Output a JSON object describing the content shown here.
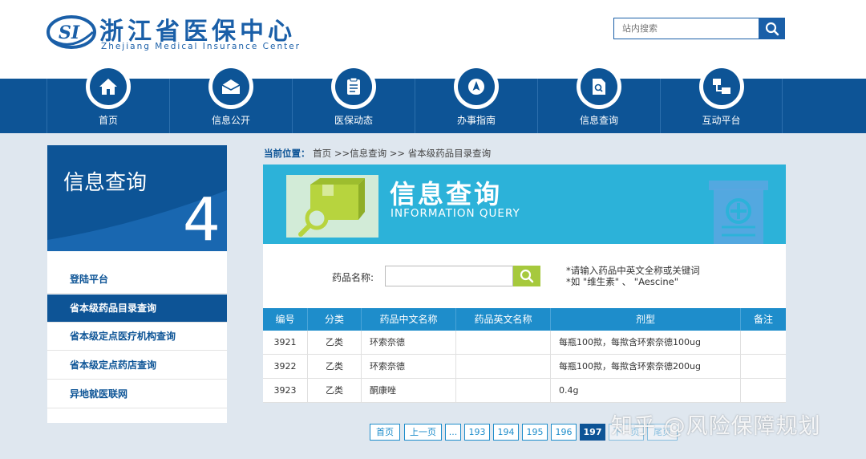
{
  "header": {
    "logo_text": "SI",
    "title": "浙江省医保中心",
    "subtitle": "Zhejiang Medical Insurance Center",
    "search": {
      "placeholder": "站内搜索"
    }
  },
  "nav": {
    "items": [
      {
        "label": "首页",
        "icon": "home-icon"
      },
      {
        "label": "信息公开",
        "icon": "envelope-icon"
      },
      {
        "label": "医保动态",
        "icon": "document-icon"
      },
      {
        "label": "办事指南",
        "icon": "compass-icon"
      },
      {
        "label": "信息查询",
        "icon": "file-search-icon"
      },
      {
        "label": "互动平台",
        "icon": "network-icon"
      }
    ]
  },
  "sidebar": {
    "title": "信息查询",
    "number": "4",
    "items": [
      {
        "label": "登陆平台"
      },
      {
        "label": "省本级药品目录查询",
        "active": true
      },
      {
        "label": "省本级定点医疗机构查询"
      },
      {
        "label": "省本级定点药店查询"
      },
      {
        "label": "异地就医联网"
      }
    ]
  },
  "breadcrumb": {
    "prefix": "当前位置：",
    "items": [
      "首页",
      ">>信息查询",
      ">>",
      "省本级药品目录查询"
    ]
  },
  "banner": {
    "title": "信息查询",
    "subtitle": "INFORMATION QUERY"
  },
  "query": {
    "label": "药品名称:",
    "value": "",
    "hint_line1": "*请输入药品中英文全称或关键词",
    "hint_line2": "*如 \"维生素\" 、 \"Aescine\""
  },
  "table": {
    "headers": [
      "编号",
      "分类",
      "药品中文名称",
      "药品英文名称",
      "剂型",
      "备注"
    ],
    "rows": [
      {
        "id": "3921",
        "category": "乙类",
        "cn_name": "环索奈德",
        "en_name": "",
        "form": "每瓶100揿，每揿含环索奈德100ug",
        "note": ""
      },
      {
        "id": "3922",
        "category": "乙类",
        "cn_name": "环索奈德",
        "en_name": "",
        "form": "每瓶100揿，每揿含环索奈德200ug",
        "note": ""
      },
      {
        "id": "3923",
        "category": "乙类",
        "cn_name": "酮康唑",
        "en_name": "",
        "form": "0.4g",
        "note": ""
      }
    ]
  },
  "pagination": {
    "first": "首页",
    "prev": "上一页",
    "ellipsis": "...",
    "pages": [
      "193",
      "194",
      "195",
      "196",
      "197"
    ],
    "current": "197",
    "next": "下一页",
    "last": "尾页"
  },
  "watermark": "知乎 @风险保障规划",
  "colors": {
    "primary": "#0d5496",
    "accent": "#1e8dcb",
    "banner": "#2cb2d9",
    "search_green": "#a6c93d",
    "background": "#dfe7ef"
  }
}
